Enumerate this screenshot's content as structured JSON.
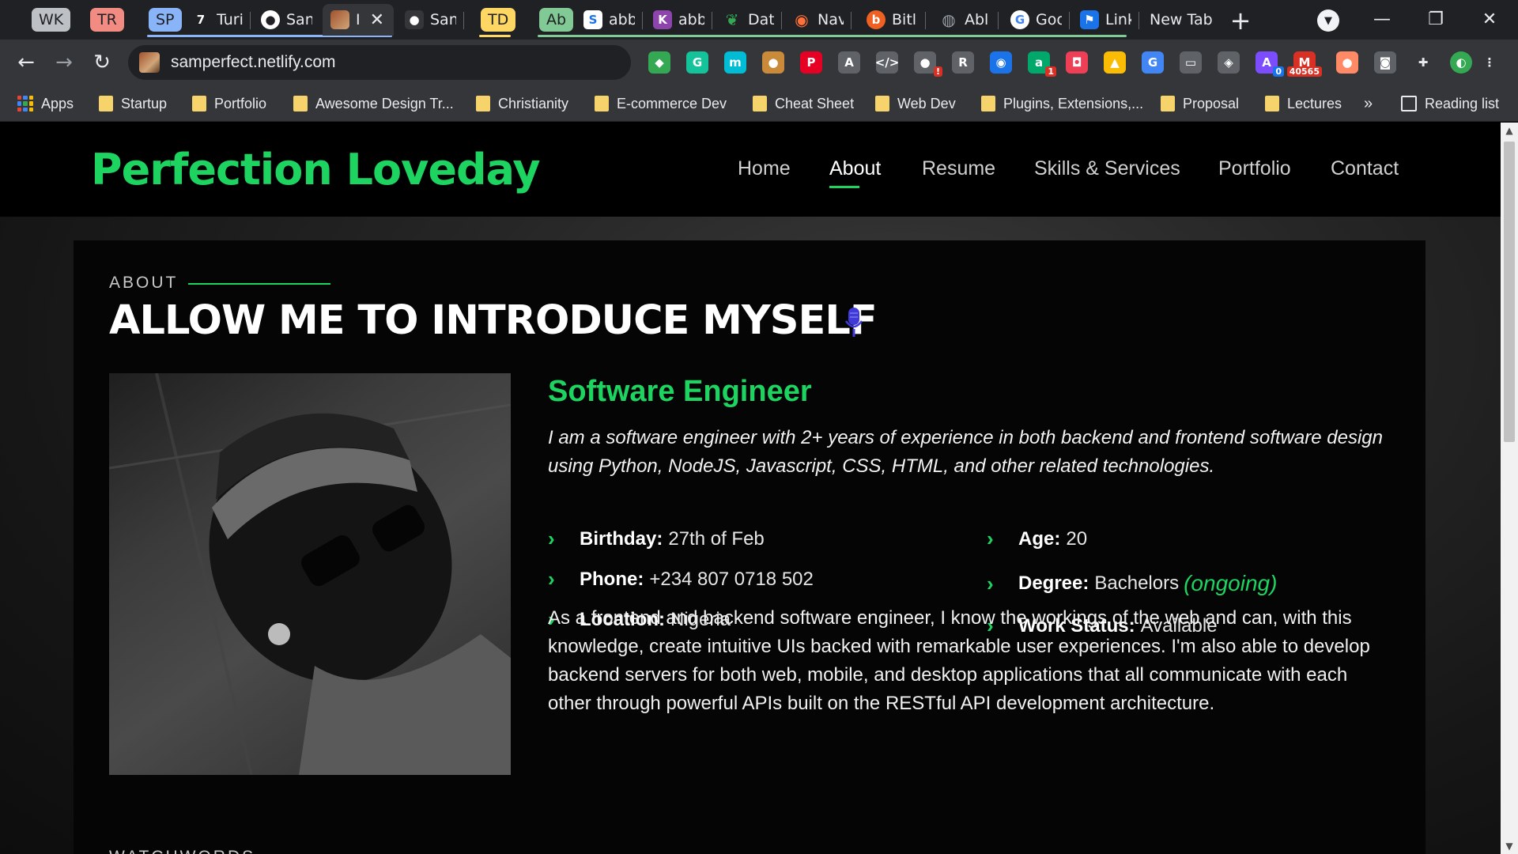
{
  "tabs": {
    "groups": [
      {
        "label": "WK",
        "color": "#bdc1c6"
      },
      {
        "label": "TR",
        "color": "#f28b82"
      },
      {
        "label": "SP",
        "color": "#8ab4f8"
      },
      {
        "label": "TD",
        "color": "#fdd663"
      },
      {
        "label": "Ab",
        "color": "#81c995"
      }
    ],
    "items": [
      {
        "title": "Turi",
        "icon": "turing-icon",
        "glyph": "7",
        "color": "#202124"
      },
      {
        "title": "San",
        "icon": "github-icon",
        "glyph": "●",
        "color": "#202124"
      },
      {
        "title": "I",
        "icon": "site-photo-icon",
        "glyph": "",
        "color": "#a0522d"
      },
      {
        "title": "San",
        "icon": "github-octocat-icon",
        "glyph": "●",
        "color": "#202124"
      },
      {
        "title": "abb",
        "icon": "s-doc-icon",
        "glyph": "S",
        "color": "#ffffff"
      },
      {
        "title": "abb",
        "icon": "k-app-icon",
        "glyph": "K",
        "color": "#8e44ad"
      },
      {
        "title": "Dat",
        "icon": "leaf-icon",
        "glyph": "❦",
        "color": "#188038"
      },
      {
        "title": "Nav",
        "icon": "firefox-icon",
        "glyph": "◉",
        "color": "#e66000"
      },
      {
        "title": "Bitl",
        "icon": "bitly-icon",
        "glyph": "b",
        "color": "#ee6123"
      },
      {
        "title": "Abl",
        "icon": "globe-icon",
        "glyph": "◍",
        "color": "#5f6368"
      },
      {
        "title": "Goo",
        "icon": "google-icon",
        "glyph": "G",
        "color": "#ffffff"
      },
      {
        "title": "Link",
        "icon": "flag-icon",
        "glyph": "⚑",
        "color": "#1a73e8"
      },
      {
        "title": "New Tab",
        "icon": "",
        "glyph": "",
        "color": ""
      }
    ],
    "new_tab": "+",
    "tab_search": "▼"
  },
  "window": {
    "minimize": "—",
    "restore": "❐",
    "close": "✕"
  },
  "toolbar": {
    "back": "←",
    "forward": "→",
    "reload": "↻",
    "url": "samperfect.netlify.com",
    "extensions": [
      {
        "name": "colorzilla-icon",
        "glyph": "◆",
        "color": "#34a853"
      },
      {
        "name": "grammarly-icon",
        "glyph": "G",
        "color": "#15c39a"
      },
      {
        "name": "m-extension-icon",
        "glyph": "m",
        "color": "#00bcd4"
      },
      {
        "name": "cookie-icon",
        "glyph": "●",
        "color": "#c98a3a"
      },
      {
        "name": "pinterest-icon",
        "glyph": "P",
        "color": "#e60023"
      },
      {
        "name": "translate-box-icon",
        "glyph": "A",
        "color": "#5f6368"
      },
      {
        "name": "code-icon",
        "glyph": "</>",
        "color": "#5f6368"
      },
      {
        "name": "recorder-icon",
        "glyph": "●",
        "color": "#5f6368",
        "badge": "!"
      },
      {
        "name": "puzzle-helper-icon",
        "glyph": "R",
        "color": "#5f6368"
      },
      {
        "name": "location-pin-icon",
        "glyph": "◉",
        "color": "#1a73e8"
      },
      {
        "name": "a-extension-icon",
        "glyph": "a",
        "color": "#00a86b",
        "badge": "1"
      },
      {
        "name": "pocket-icon",
        "glyph": "◘",
        "color": "#ef3f56"
      },
      {
        "name": "google-drive-icon",
        "glyph": "▲",
        "color": "#fbbc04"
      },
      {
        "name": "google-translate-icon",
        "glyph": "G",
        "color": "#4285f4"
      },
      {
        "name": "printer-icon",
        "glyph": "▭",
        "color": "#5f6368"
      },
      {
        "name": "shield-icon",
        "glyph": "◈",
        "color": "#5f6368"
      },
      {
        "name": "ai-extension-icon",
        "glyph": "A",
        "color": "#7c4dff",
        "badge": "0",
        "badge_blue": true
      },
      {
        "name": "gmail-icon",
        "glyph": "M",
        "color": "#d93025",
        "badge": "40565"
      },
      {
        "name": "capsule-icon",
        "glyph": "●",
        "color": "#ff8a65"
      },
      {
        "name": "camera-icon",
        "glyph": "◙",
        "color": "#5f6368"
      },
      {
        "name": "extensions-puzzle-icon",
        "glyph": "✚",
        "color": "#e8eaed"
      },
      {
        "name": "profile-avatar-icon",
        "glyph": "◐",
        "color": "#34a853"
      },
      {
        "name": "menu-kebab-icon",
        "glyph": "⋮",
        "color": "#e8eaed"
      }
    ]
  },
  "bookmarks": {
    "apps": "Apps",
    "items": [
      "Startup",
      "Portfolio",
      "Awesome Design Tr...",
      "Christianity",
      "E-commerce Dev",
      "Cheat Sheet",
      "Web Dev",
      "Plugins, Extensions,...",
      "Proposal",
      "Lectures"
    ],
    "more": "»",
    "reading_list": "Reading list"
  },
  "site": {
    "brand": "Perfection Loveday",
    "nav": [
      "Home",
      "About",
      "Resume",
      "Skills & Services",
      "Portfolio",
      "Contact"
    ],
    "active_nav": "About",
    "accent": "#1ed461",
    "about": {
      "eyebrow": "ABOUT",
      "heading": "ALLOW ME TO INTRODUCE MYSELF",
      "role": "Software Engineer",
      "intro": "I am a software engineer with 2+ years of experience in both backend and frontend software design using Python, NodeJS, Javascript, CSS, HTML, and other related technologies.",
      "facts_left": [
        {
          "label": "Birthday:",
          "value": "27th of Feb"
        },
        {
          "label": "Phone:",
          "value": "+234 807 0718 502"
        },
        {
          "label": "Location:",
          "value": "Nigeria"
        }
      ],
      "facts_right": [
        {
          "label": "Age:",
          "value": "20"
        },
        {
          "label": "Degree:",
          "value": "Bachelors",
          "note": "(ongoing)"
        },
        {
          "label": "Work Status:",
          "value": "Available"
        }
      ],
      "bio": "As a frontend and backend software engineer, I know the workings of the web and can, with this knowledge, create intuitive UIs backed with remarkable user experiences. I'm also able to develop backend servers for both web, mobile, and desktop applications that all communicate with each other through powerful APIs built on the RESTful API development architecture.",
      "next_section": "WATCHWORDS"
    }
  }
}
